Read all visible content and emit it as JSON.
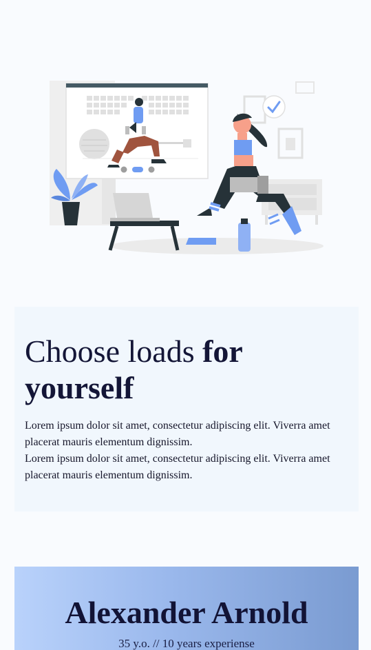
{
  "hero": {
    "illustration": "woman-lunge-workout-with-video-call-illustration"
  },
  "info_card": {
    "title_regular": "Choose loads ",
    "title_bold": "for yourself",
    "paragraph_1": "Lorem ipsum dolor sit amet, consectetur adipiscing elit. Viverra amet placerat mauris elementum dignissim.",
    "paragraph_2": "Lorem ipsum dolor sit amet, consectetur adipiscing elit. Viverra amet placerat mauris elementum dignissim."
  },
  "profile_card": {
    "name": "Alexander Arnold",
    "meta": "35 y.o. // 10 years experiense"
  },
  "colors": {
    "background": "#f9fbfe",
    "card": "#f1f7fd",
    "accent_blue": "#6f9cf2",
    "navy": "#263238",
    "text_dark": "#141637"
  }
}
